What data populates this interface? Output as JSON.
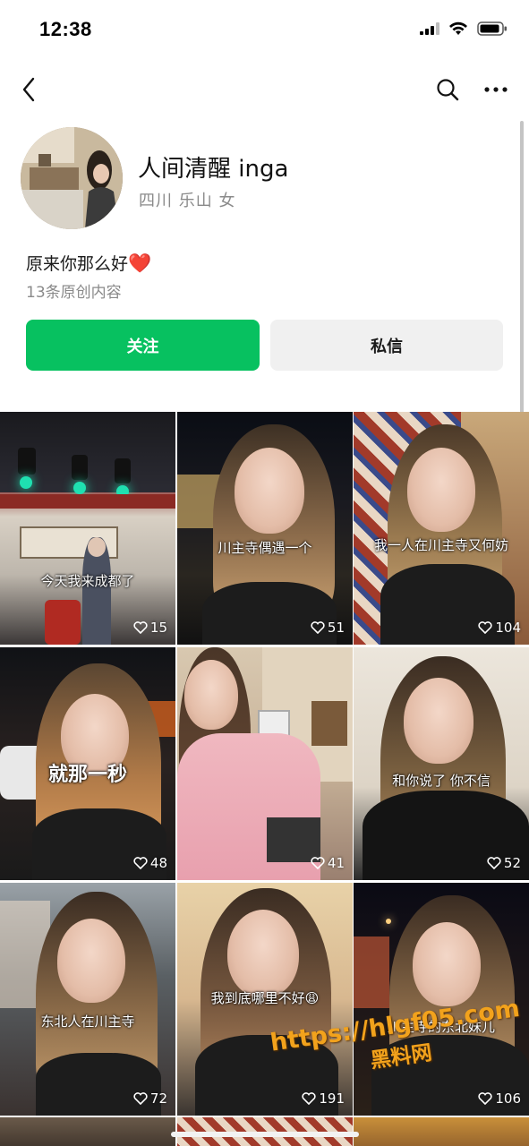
{
  "status_bar": {
    "time": "12:38"
  },
  "profile": {
    "name": "人间清醒 inga",
    "location": "四川 乐山 女",
    "bio": "原来你那么好",
    "bio_emoji": "❤️",
    "post_count": "13条原创内容"
  },
  "actions": {
    "follow": "关注",
    "message": "私信"
  },
  "posts": [
    {
      "caption": "今天我来成都了",
      "likes": "15"
    },
    {
      "caption": "川主寺偶遇一个",
      "likes": "51"
    },
    {
      "caption": "我一人在川主寺又何妨",
      "likes": "104"
    },
    {
      "caption": "就那一秒",
      "likes": "48"
    },
    {
      "caption": "",
      "likes": "41"
    },
    {
      "caption": "和你说了 你不信",
      "likes": "52"
    },
    {
      "caption": "东北人在川主寺",
      "likes": "72"
    },
    {
      "caption": "我到底哪里不好😩",
      "likes": "191"
    },
    {
      "caption": "川主寺的东北妹儿",
      "likes": "106"
    }
  ],
  "watermark": {
    "url": "https://hlgf05.com",
    "name": "黑料网"
  },
  "icons": [
    "signal-icon",
    "wifi-icon",
    "battery-icon",
    "back-icon",
    "search-icon",
    "more-icon",
    "heart-icon"
  ],
  "colors": {
    "accent": "#07c160",
    "secondary_button": "#f0f0f0",
    "watermark": "#f2a21c"
  }
}
